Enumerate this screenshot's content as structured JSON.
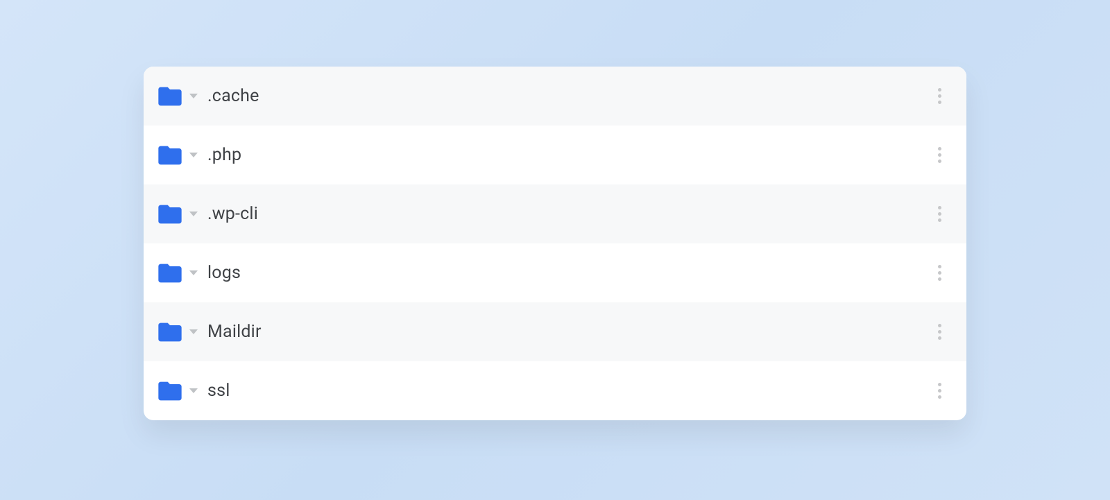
{
  "colors": {
    "folder": "#2f6fed",
    "text": "#3f4246"
  },
  "list": {
    "items": [
      {
        "name": ".cache"
      },
      {
        "name": ".php"
      },
      {
        "name": ".wp-cli"
      },
      {
        "name": "logs"
      },
      {
        "name": "Maildir"
      },
      {
        "name": "ssl"
      }
    ]
  }
}
